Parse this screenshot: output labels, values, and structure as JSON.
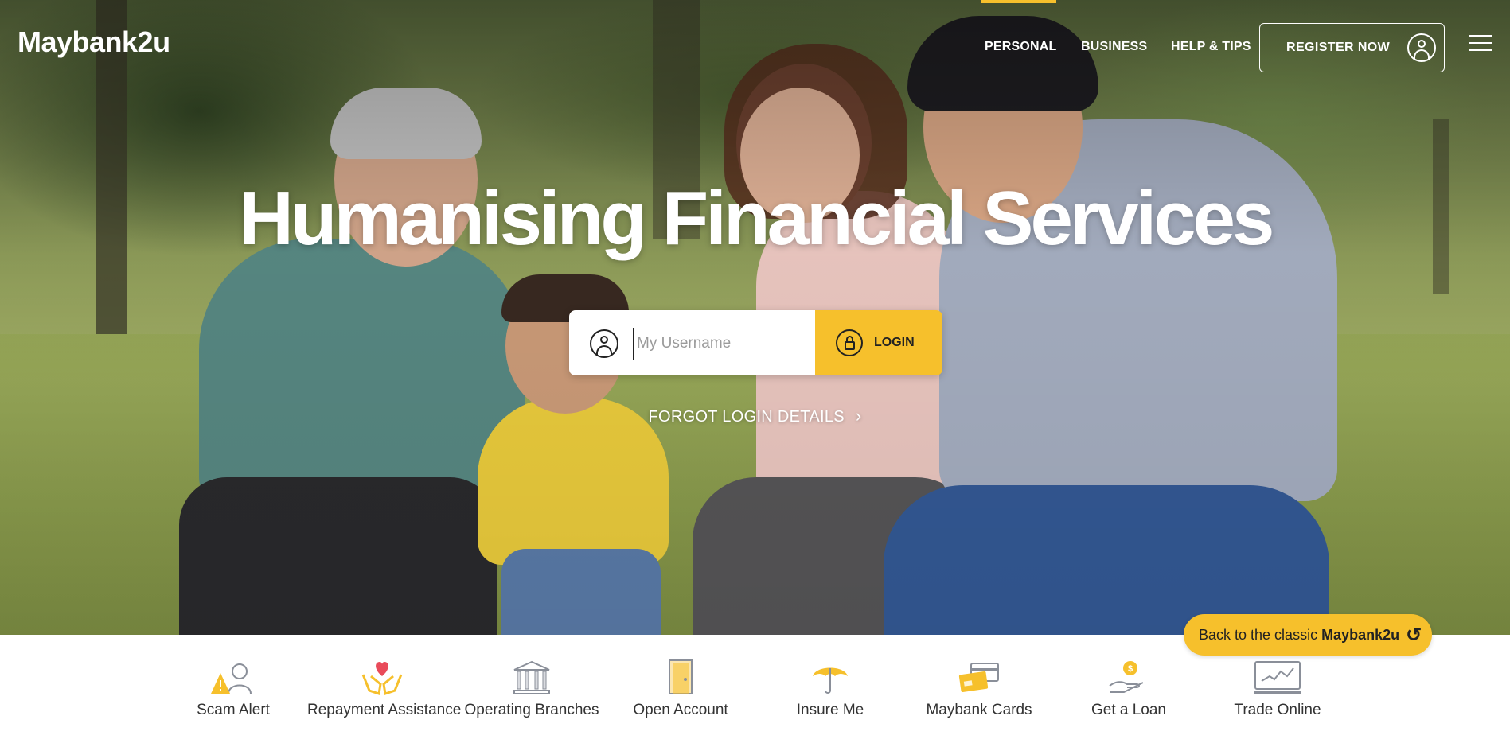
{
  "brand": {
    "logo_text": "Maybank2u",
    "accent_color": "#f6c02c"
  },
  "nav": {
    "items": [
      "PERSONAL",
      "BUSINESS",
      "HELP & TIPS"
    ],
    "register_label": "REGISTER NOW",
    "active_item": "PERSONAL"
  },
  "hero": {
    "headline": "Humanising Financial Services",
    "username_placeholder": "My Username",
    "login_label": "LOGIN",
    "forgot_label": "FORGOT LOGIN DETAILS"
  },
  "classic_button": {
    "prefix": "Back to the classic",
    "brand": "Maybank2u"
  },
  "quick_links": [
    {
      "label": "Scam Alert",
      "icon": "scam-alert-icon"
    },
    {
      "label": "Repayment Assistance",
      "icon": "repayment-heart-icon"
    },
    {
      "label": "Operating Branches",
      "icon": "bank-building-icon"
    },
    {
      "label": "Open Account",
      "icon": "door-icon"
    },
    {
      "label": "Insure Me",
      "icon": "umbrella-icon"
    },
    {
      "label": "Maybank Cards",
      "icon": "cards-icon"
    },
    {
      "label": "Get a Loan",
      "icon": "loan-hand-icon"
    },
    {
      "label": "Trade Online",
      "icon": "trade-chart-icon"
    }
  ]
}
